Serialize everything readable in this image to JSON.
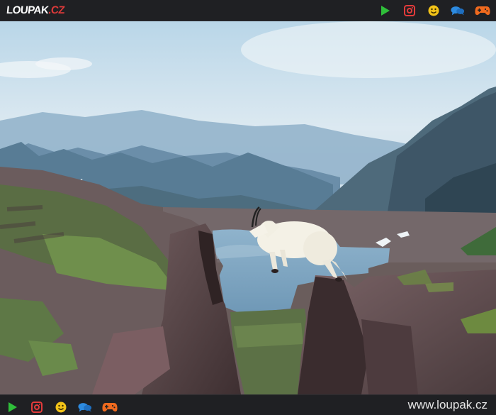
{
  "header": {
    "logo_main": "LOUPAK",
    "logo_dot": ".",
    "logo_tld": "CZ"
  },
  "nav_icons": [
    "play-icon",
    "instagram-icon",
    "smiley-icon",
    "chat-icon",
    "gamepad-icon"
  ],
  "colors": {
    "bar": "#1f2023",
    "play": "#2fbf3a",
    "instagram": "#e23b3b",
    "smiley": "#f2c318",
    "chat": "#2d8be0",
    "gamepad": "#f06a1e",
    "logo_accent": "#e03a3a"
  },
  "photo": {
    "subject": "mountain-goat-jumping",
    "scene": "alpine-mountain-lake"
  },
  "footer": {
    "url": "www.loupak.cz"
  }
}
